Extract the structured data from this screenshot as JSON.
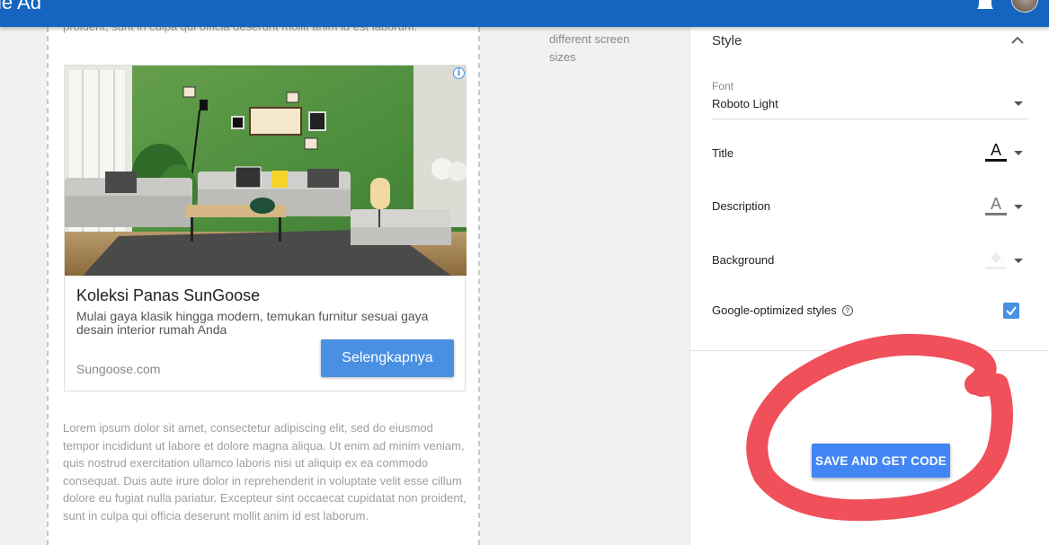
{
  "header": {
    "title": "cle Ad"
  },
  "preview": {
    "top_text": "proident, sunt in culpa qui officia deserunt mollit anim id est laborum.",
    "ad": {
      "headline": "Koleksi Panas SunGoose",
      "description": "Mulai gaya klasik hingga modern, temukan furnitur sesuai gaya desain interior rumah Anda",
      "domain": "Sungoose.com",
      "cta_label": "Selengkapnya",
      "info_icon": "i"
    },
    "lorem": "Lorem ipsum dolor sit amet, consectetur adipiscing elit, sed do eiusmod tempor incididunt ut labore et dolore magna aliqua. Ut enim ad minim veniam, quis nostrud exercitation ullamco laboris nisi ut aliquip ex ea commodo consequat. Duis aute irure dolor in reprehenderit in voluptate velit esse cillum dolore eu fugiat nulla pariatur. Excepteur sint occaecat cupidatat non proident, sunt in culpa qui officia deserunt mollit anim id est laborum."
  },
  "middle": {
    "text": "different screen sizes"
  },
  "panel": {
    "section_title": "Style",
    "font_label": "Font",
    "font_value": "Roboto Light",
    "title_label": "Title",
    "description_label": "Description",
    "background_label": "Background",
    "google_styles_label": "Google-optimized styles",
    "help_glyph": "?",
    "letter_glyph": "A",
    "google_styles_checked": true,
    "title_color": "#111111",
    "description_color": "#7a7a7a",
    "background_color": "#eeeeee"
  },
  "actions": {
    "save_label": "SAVE AND GET CODE"
  },
  "colors": {
    "header_bg": "#1565c0",
    "accent": "#4a90e2",
    "save_button": "#4285f4",
    "annotation": "#f0505a"
  }
}
